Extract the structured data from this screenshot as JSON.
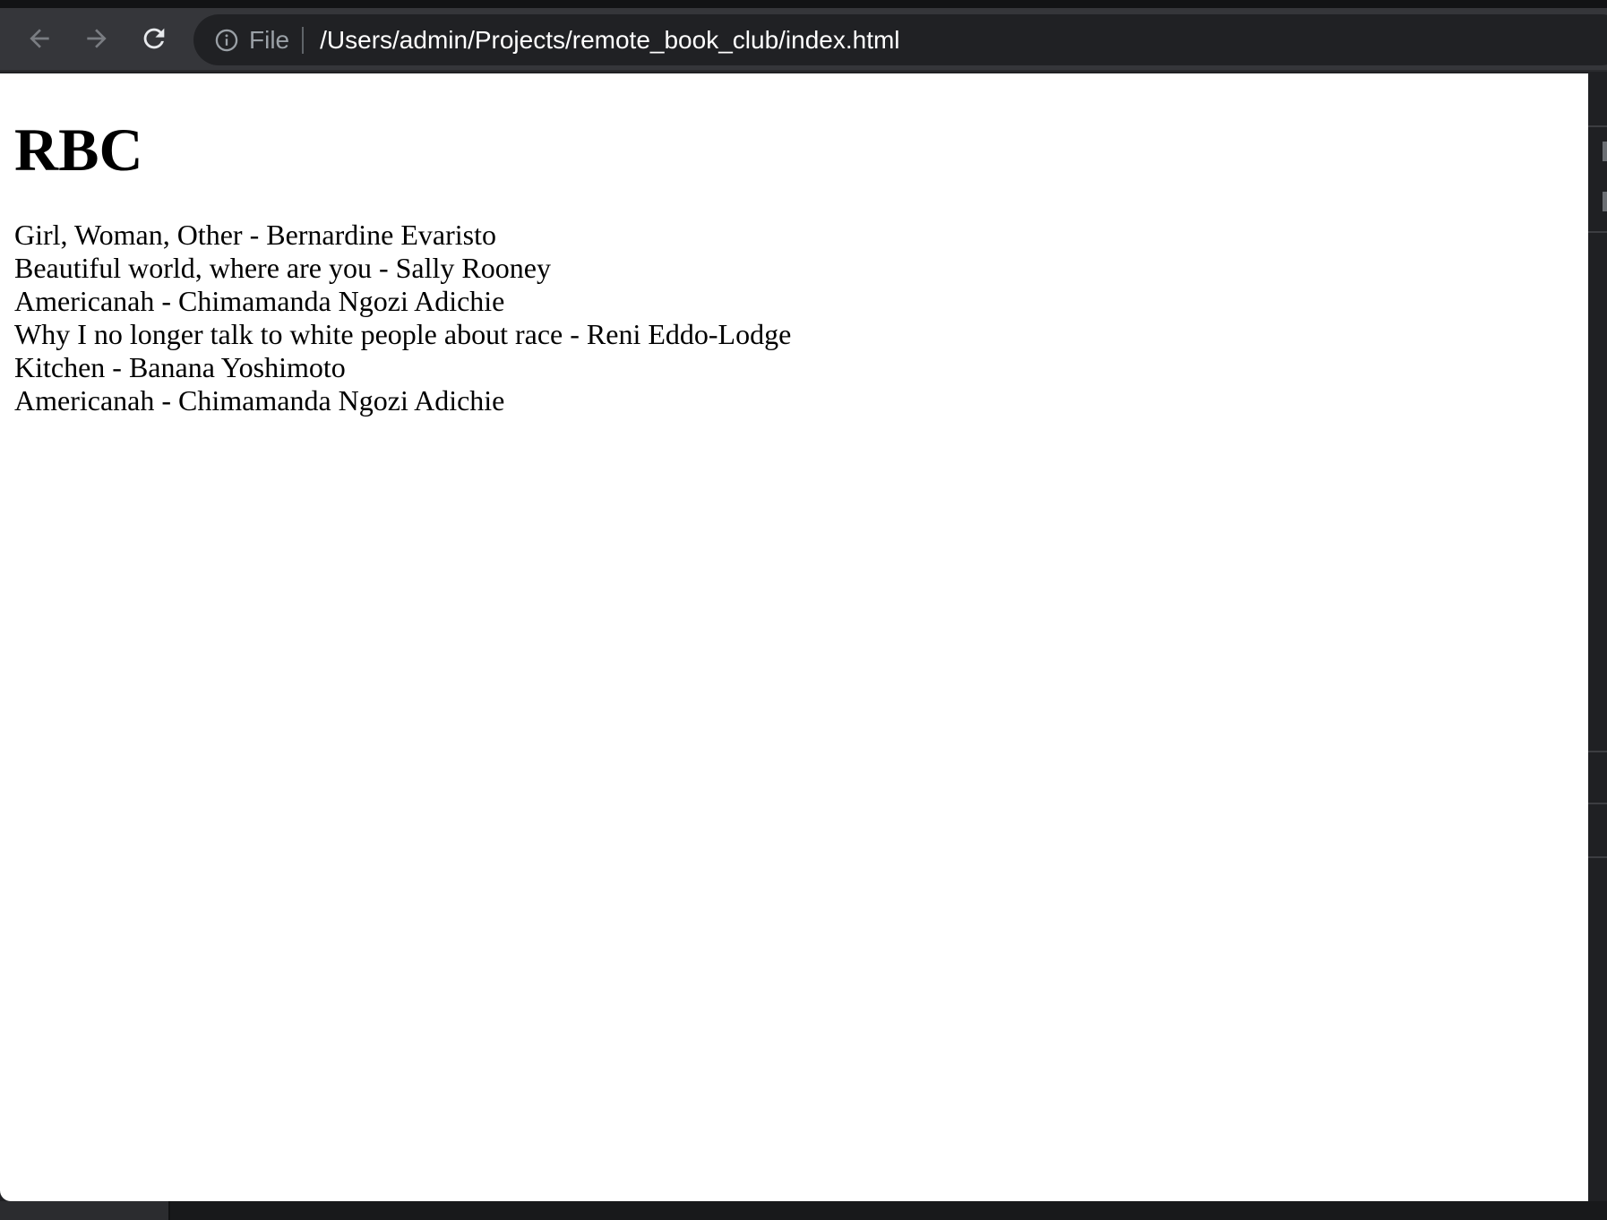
{
  "browser": {
    "scheme_label": "File",
    "url": "/Users/admin/Projects/remote_book_club/index.html",
    "icons": {
      "back": "arrow-left-icon",
      "forward": "arrow-right-icon",
      "reload": "reload-icon",
      "info": "info-icon"
    }
  },
  "page": {
    "heading": "RBC",
    "books": [
      "Girl, Woman, Other - Bernardine Evaristo",
      "Beautiful world, where are you - Sally Rooney",
      "Americanah - Chimamanda Ngozi Adichie",
      "Why I no longer talk to white people about race - Reni Eddo-Lodge",
      "Kitchen - Banana Yoshimoto",
      "Americanah - Chimamanda Ngozi Adichie"
    ]
  },
  "colors": {
    "toolbar": "#35363a",
    "omnibox": "#202124",
    "url_text": "#ffffff",
    "scheme_text": "#9aa0a6",
    "page_background": "#ffffff"
  }
}
